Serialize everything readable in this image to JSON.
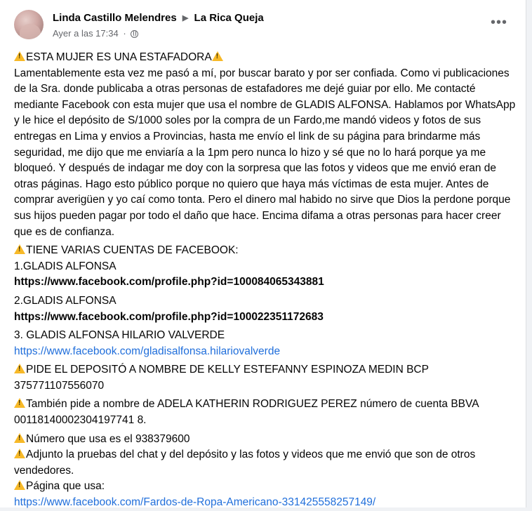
{
  "post": {
    "author": "Linda Castillo Melendres",
    "group": "La Rica Queja",
    "timestamp": "Ayer a las 17:34",
    "separator_dot": "·",
    "more_label": "•••"
  },
  "icons": {
    "avatar": "profile-photo",
    "arrow": "triangle-right-icon",
    "privacy": "globe-icon",
    "warning": "warning-icon",
    "warning_color": "#f7b928",
    "link_color": "#216fdb"
  },
  "content": {
    "title": "ESTA MUJER ES UNA ESTAFADORA",
    "p1": "Lamentablemente esta vez me pasó a mí, por buscar barato y por ser confiada. Como vi publicaciones de la Sra. donde publicaba a otras personas de estafadores me dejé guiar por ello. Me contacté mediante Facebook con esta mujer que usa el nombre de GLADIS ALFONSA. Hablamos por WhatsApp y le hice el depósito de S/1000 soles por la compra de un Fardo,me mandó videos y fotos de sus entregas en Lima y envios a Provincias, hasta me envío el link de su página para brindarme más seguridad, me dijo que me enviaría a la 1pm pero nunca lo hizo y sé que no lo hará porque ya me  bloqueó. Y después de indagar me doy con la sorpresa que las fotos y videos que me envió eran de otras páginas. Hago esto público porque no quiero que haya más víctimas de esta mujer. Antes de comprar averigüen y yo caí como tonta. Pero el dinero mal habido no sirve que Dios la perdone porque sus hijos pueden pagar por todo el daño que hace. Encima difama a otras personas para hacer creer que es de confianza.",
    "accounts_heading": "TIENE VARIAS CUENTAS DE FACEBOOK:",
    "acc1_name": " 1.GLADIS ALFONSA",
    "acc1_url": "https://www.facebook.com/profile.php?id=100084065343881",
    "acc2_name": "2.GLADIS ALFONSA",
    "acc2_url": "https://www.facebook.com/profile.php?id=100022351172683",
    "acc3_name": "3. GLADIS ALFONSA HILARIO VALVERDE",
    "acc3_url": "https://www.facebook.com/gladisalfonsa.hilariovalverde",
    "deposit_note": "PIDE EL DEPOSITÓ A NOMBRE DE KELLY ESTEFANNY ESPINOZA MEDIN BCP 375771107556070",
    "deposit_note2": "También pide a nombre de ADELA KATHERIN RODRIGUEZ PEREZ número de cuenta BBVA 00118140002304197741 8.",
    "phone_note": "Número que usa es el 938379600",
    "attach_note": "Adjunto la pruebas del chat y del depósito y las fotos y videos que me envió que son de otros vendedores.",
    "page_label": "Página que usa:",
    "page_url": "https://www.facebook.com/Fardos-de-Ropa-Americano-331425558257149/"
  }
}
